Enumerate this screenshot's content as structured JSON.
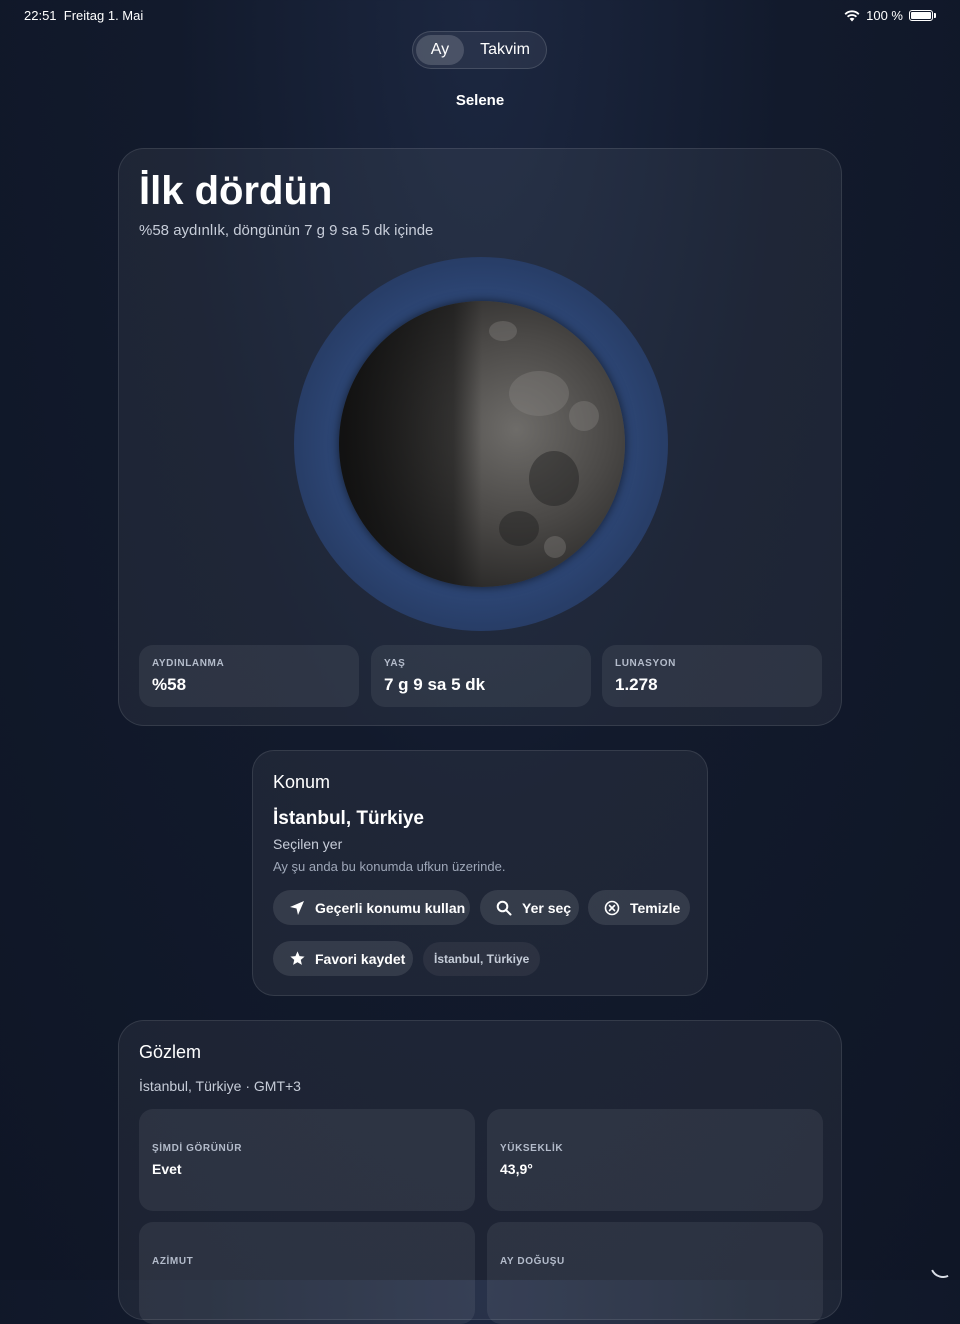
{
  "status_bar": {
    "time": "22:51",
    "date": "Freitag 1. Mai",
    "battery": "100 %"
  },
  "segmented": {
    "options": [
      "Ay",
      "Takvim"
    ],
    "selected": "Ay"
  },
  "app_title": "Selene",
  "phase": {
    "name": "İlk dördün",
    "subtitle": "%58 aydınlık, döngünün 7 g 9 sa 5 dk içinde",
    "illumination_fraction": 0.58,
    "stats": [
      {
        "label": "AYDINLANMA",
        "value": "%58"
      },
      {
        "label": "YAŞ",
        "value": "7 g 9 sa 5 dk"
      },
      {
        "label": "LUNASYON",
        "value": "1.278"
      }
    ]
  },
  "location": {
    "title": "Konum",
    "name": "İstanbul, Türkiye",
    "subtitle": "Seçilen yer",
    "note": "Ay şu anda bu konumda ufkun üzerinde.",
    "buttons": {
      "use_current": "Geçerli konumu kullan",
      "choose": "Yer seç",
      "clear": "Temizle",
      "save_favorite": "Favori kaydet"
    },
    "favorite_chip": "İstanbul, Türkiye"
  },
  "observation": {
    "title": "Gözlem",
    "subtitle": "İstanbul, Türkiye · GMT+3",
    "tiles": [
      {
        "label": "ŞİMDİ GÖRÜNÜR",
        "value": "Evet"
      },
      {
        "label": "YÜKSEKLİK",
        "value": "43,9°"
      },
      {
        "label": "AZİMUT",
        "value": ""
      },
      {
        "label": "AY DOĞUŞU",
        "value": ""
      }
    ]
  }
}
